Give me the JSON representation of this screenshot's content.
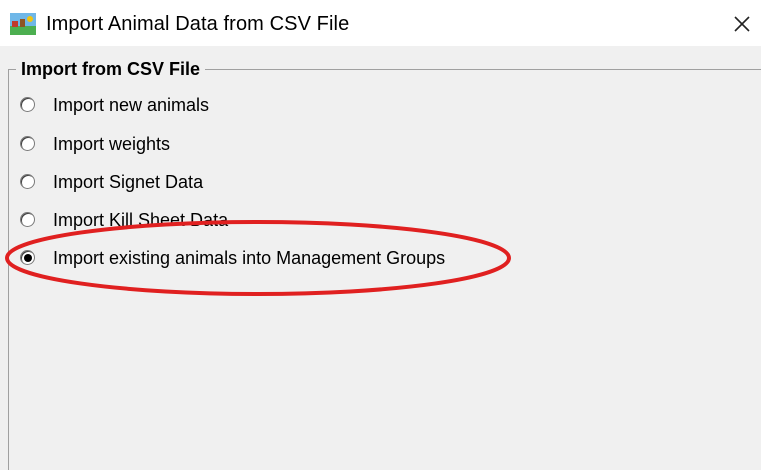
{
  "window": {
    "title": "Import Animal Data from CSV File",
    "icon": "app-landscape-icon",
    "close_icon": "close-icon"
  },
  "group": {
    "legend": "Import from CSV File"
  },
  "options": [
    {
      "label": "Import new animals",
      "checked": false
    },
    {
      "label": "Import weights",
      "checked": false
    },
    {
      "label": "Import Signet Data",
      "checked": false
    },
    {
      "label": "Import Kill Sheet Data",
      "checked": false
    },
    {
      "label": "Import existing animals into Management Groups",
      "checked": true
    }
  ],
  "highlight": {
    "color": "#e02020",
    "target": "Import existing animals into Management Groups"
  }
}
